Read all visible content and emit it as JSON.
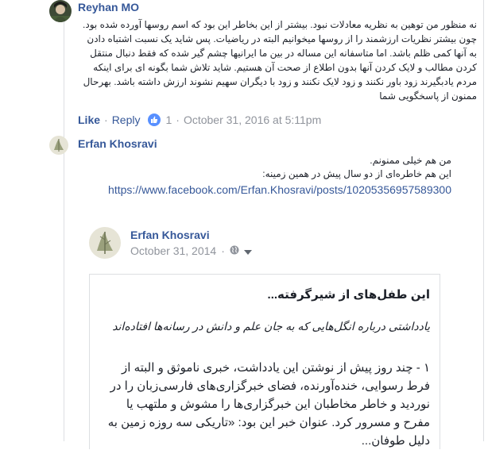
{
  "comment1": {
    "author": "Reyhan MO",
    "text": "نه منظور من توهین به نظریه معادلات نبود. بیشتر از این بخاطر این بود که اسم روسها آورده شده بود. چون بیشتر نظریات ارزشمند را از روسها میخوانیم البته در ریاضیات. پس شاید یک نسبت اشتباه دادن به آنها کمی ظلم باشد. اما متاسفانه این مساله در بین ما ایرانیها چشم گیر شده که فقط دنبال منتقل کردن مطالب و لایک کردن آنها بدون اطلاع از صحت آن هستیم. شاید تلاش شما بگونه ای برای اینکه مردم یادبگیرند زود باور نکنند و زود لایک نکنند و زود با دیگران سهیم نشوند ارزش داشته باشد. بهرحال ممنون از پاسخگویی شما",
    "like_label": "Like",
    "reply_label": "Reply",
    "reaction_count": "1",
    "timestamp": "October 31, 2016 at 5:11pm"
  },
  "comment2": {
    "author": "Erfan Khosravi",
    "line1": "من هم خیلی ممنونم.",
    "line2": "این هم خاطره‌ای از دو سال پیش در همین زمینه:",
    "link": "https://www.facebook.com/Erfan.Khosravi/posts/10205356957589300"
  },
  "shared_post": {
    "author": "Erfan Khosravi",
    "date": "October 31, 2014",
    "separator": "·",
    "privacy_icon": "globe-icon",
    "dropdown_icon": "caret-down-icon",
    "note": {
      "title": "این طفل‌های از شیرگرفته...",
      "subtitle": "یادداشتی درباره انگل‌هایی که به جان علم و دانش در رسانه‌ها افتاده‌اند",
      "body": "۱ - چند روز پیش از نوشتن این یادداشت، خبری ناموثق و البته از فرط رسوایی، خنده‌آورنده، فضای خبرگزاری‌های فارسی‌زبان را در نوردید و خاطر مخاطبان این خبرگزاری‌ها را مشوش و ملتهب یا مفرح و مسرور کرد. عنوان خبر این بود: «تاریکی سه روزه زمین به دلیل طوفان..."
    }
  },
  "colors": {
    "link": "#365899",
    "meta": "#90949c",
    "text": "#1d2129",
    "like_badge": "#5890ff",
    "border": "#dddfe2"
  }
}
